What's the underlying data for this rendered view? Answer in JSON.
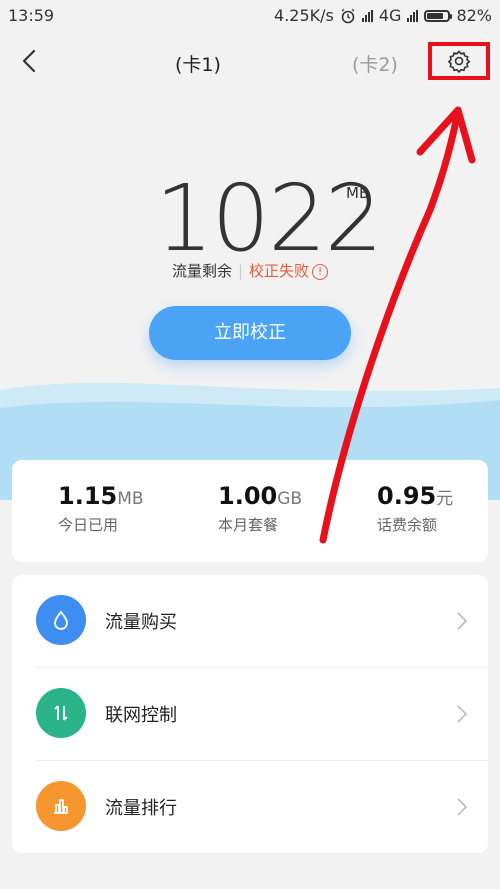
{
  "status_bar": {
    "time": "13:59",
    "speed": "4.25K/s",
    "network": "4G",
    "battery": "82%",
    "battery_level": 0.82
  },
  "header": {
    "tab_card1": "(卡1)",
    "tab_card2": "(卡2)"
  },
  "usage": {
    "value": "1022",
    "unit": "MB",
    "label": "流量剩余",
    "status": "校正失败",
    "status_icon": "!"
  },
  "calibrate_button": "立即校正",
  "stats": [
    {
      "value": "1.15",
      "unit": "MB",
      "label": "今日已用"
    },
    {
      "value": "1.00",
      "unit": "GB",
      "label": "本月套餐"
    },
    {
      "value": "0.95",
      "unit": "元",
      "label": "话费余额"
    }
  ],
  "menu": [
    {
      "label": "流量购买",
      "icon": "drop-icon",
      "color": "#3d8ef0"
    },
    {
      "label": "联网控制",
      "icon": "updown-arrows-icon",
      "color": "#2bb38a"
    },
    {
      "label": "流量排行",
      "icon": "bar-chart-icon",
      "color": "#f5962e"
    }
  ],
  "colors": {
    "accent": "#4aa3f5",
    "error": "#e45a3a",
    "highlight_box": "#e8101a"
  }
}
